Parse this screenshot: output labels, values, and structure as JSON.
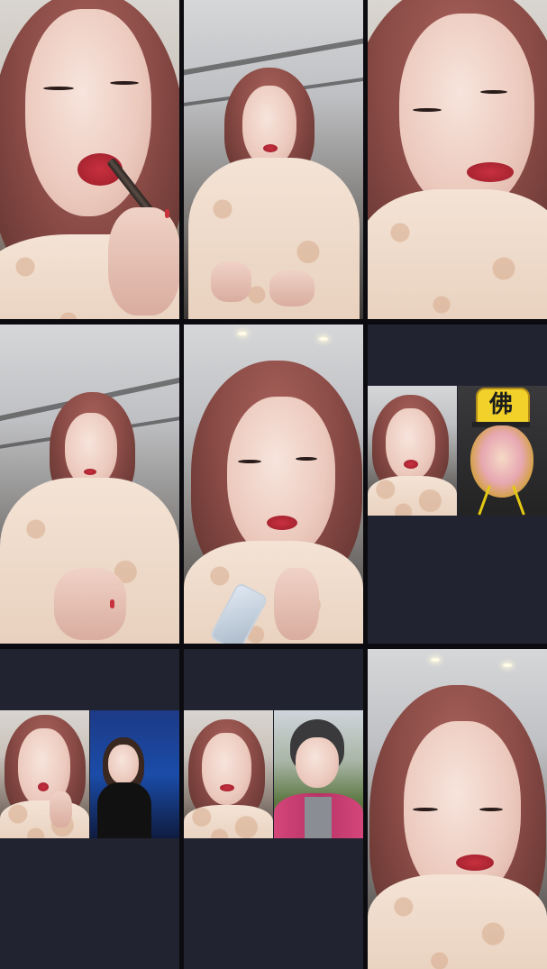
{
  "app": {
    "layout": "3x3 video grid"
  },
  "colors": {
    "empty_cell": "#222331",
    "divider": "#0c0c10",
    "accent_lip": "#c8303e",
    "crown": "#f2d12b"
  },
  "tiles": [
    {
      "id": 1,
      "content": "host-close-up-lipstick"
    },
    {
      "id": 2,
      "content": "host-standing-in-robe"
    },
    {
      "id": 3,
      "content": "host-smiling-close-up"
    },
    {
      "id": 4,
      "content": "host-pointing-at-camera"
    },
    {
      "id": 5,
      "content": "host-holding-phone"
    },
    {
      "id": 6,
      "content": "split-host-and-monkey-mask"
    },
    {
      "id": 7,
      "content": "split-host-and-guest-studio"
    },
    {
      "id": 8,
      "content": "split-host-and-guest-outdoor"
    },
    {
      "id": 9,
      "content": "host-looking-down"
    }
  ],
  "icons": {
    "crown_glyph": "佛"
  }
}
